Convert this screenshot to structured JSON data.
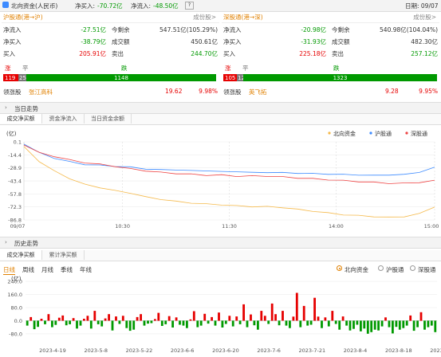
{
  "titlebar": {
    "title": "北向资金(人民币)",
    "inflow_label": "净买入:",
    "inflow_value": "-70.72亿",
    "inflow2_label": "净流入:",
    "inflow2_value": "-48.50亿",
    "date_label": "日期: 09/07"
  },
  "sh": {
    "name": "沪股通(港→沪)",
    "link": "成份股>",
    "rows": [
      {
        "l1": "净流入",
        "v1": "-27.51亿",
        "l2": "今剩余",
        "v2": "547.51亿(105.29%)"
      },
      {
        "l1": "净买入",
        "v1": "-38.79亿",
        "l2": "成交额",
        "v2": "450.61亿"
      },
      {
        "l1": "买入",
        "v1": "205.91亿",
        "l2": "卖出",
        "v2": "244.70亿"
      }
    ],
    "up_label": "涨",
    "flat_label": "平",
    "down_label": "跌",
    "up": "119",
    "flat": "25",
    "down": "1148",
    "leader_label": "领涨股",
    "leader_name": "张江高科",
    "leader_price": "19.62",
    "leader_pct": "9.98%"
  },
  "sz": {
    "name": "深股通(港→深)",
    "link": "成份股>",
    "rows": [
      {
        "l1": "净流入",
        "v1": "-20.98亿",
        "l2": "今剩余",
        "v2": "540.98亿(104.04%)"
      },
      {
        "l1": "净买入",
        "v1": "-31.93亿",
        "l2": "成交额",
        "v2": "482.30亿"
      },
      {
        "l1": "买入",
        "v1": "225.18亿",
        "l2": "卖出",
        "v2": "257.12亿"
      }
    ],
    "up_label": "涨",
    "flat_label": "平",
    "down_label": "跌",
    "up": "105",
    "flat": "12",
    "down": "1323",
    "leader_label": "领涨股",
    "leader_name": "英飞拓",
    "leader_price": "9.28",
    "leader_pct": "9.95%"
  },
  "intraday": {
    "section_title": "当日走势",
    "tabs": [
      "成交净买额",
      "资金净流入",
      "当日资金余额"
    ],
    "unit": "(亿)",
    "legend": [
      "北向资金",
      "沪股通",
      "深股通"
    ]
  },
  "history": {
    "section_title": "历史走势",
    "tabs": [
      "成交净买额",
      "累计净买额"
    ],
    "periods": [
      "日线",
      "周线",
      "月线",
      "季线",
      "年线"
    ],
    "radios": [
      "北向资金",
      "沪股通",
      "深股通"
    ],
    "unit": "(亿)"
  },
  "colors": {
    "north": "#f5b94a",
    "sh": "#3d8bff",
    "sz": "#ee4444",
    "up": "#e60000",
    "down": "#009900"
  },
  "chart_data": [
    {
      "type": "line",
      "y_ticks": [
        "0.1",
        "-14.4",
        "-28.9",
        "-43.4",
        "-57.8",
        "-72.3",
        "-86.8"
      ],
      "x_ticks": [
        "09/07",
        "10:30",
        "11:30",
        "14:00",
        "15:00"
      ],
      "ylim": [
        -86.8,
        0.1
      ],
      "series": [
        {
          "name": "北向资金",
          "values": [
            -5,
            -22,
            -32,
            -41,
            -47,
            -51,
            -54,
            -57,
            -61,
            -64,
            -66,
            -68,
            -69,
            -70,
            -71,
            -72,
            -72,
            -73,
            -75,
            -77,
            -79,
            -81,
            -82,
            -83,
            -84,
            -83,
            -80,
            -72
          ]
        },
        {
          "name": "沪股通",
          "values": [
            -2,
            -12,
            -18,
            -22,
            -25,
            -26,
            -27,
            -28,
            -30,
            -31,
            -31,
            -32,
            -32,
            -33,
            -33,
            -34,
            -34,
            -34,
            -35,
            -35,
            -36,
            -36,
            -37,
            -37,
            -37,
            -36,
            -34,
            -28
          ]
        },
        {
          "name": "深股通",
          "values": [
            -3,
            -12,
            -16,
            -20,
            -23,
            -25,
            -27,
            -30,
            -32,
            -34,
            -35,
            -36,
            -37,
            -37,
            -38,
            -38,
            -38,
            -39,
            -40,
            -41,
            -42,
            -43,
            -44,
            -45,
            -46,
            -46,
            -45,
            -43
          ]
        }
      ]
    },
    {
      "type": "bar",
      "y_ticks": [
        "240.0",
        "160.0",
        "80.0",
        "0.0",
        "-80.0"
      ],
      "x_ticks": [
        "2023-4-19",
        "2023-5-8",
        "2023-5-22",
        "2023-6-6",
        "2023-6-20",
        "2023-7-6",
        "2023-7-21",
        "2023-8-4",
        "2023-8-18",
        "2023-9-4"
      ],
      "ylim": [
        -100,
        260
      ],
      "values": [
        -30,
        22,
        -52,
        -38,
        12,
        -22,
        40,
        -40,
        -26,
        18,
        32,
        -28,
        -22,
        16,
        -48,
        -30,
        12,
        30,
        -48,
        60,
        -22,
        -35,
        14,
        40,
        -60,
        26,
        -20,
        30,
        -45,
        -62,
        -55,
        22,
        40,
        -30,
        -18,
        -15,
        10,
        48,
        -32,
        -22,
        28,
        -42,
        20,
        -25,
        -30,
        -45,
        8,
        58,
        -40,
        -30,
        42,
        -18,
        22,
        -30,
        50,
        -42,
        -20,
        30,
        -35,
        26,
        -22,
        100,
        -40,
        38,
        -28,
        -55,
        60,
        30,
        -20,
        105,
        40,
        -28,
        60,
        -30,
        -45,
        25,
        170,
        -40,
        90,
        -30,
        -25,
        140,
        25,
        -45,
        20,
        -35,
        60,
        -20,
        -55,
        26,
        -30,
        -60,
        -50,
        -25,
        -65,
        -48,
        -80,
        -70,
        -55,
        -60,
        -35,
        20,
        -40,
        -78,
        -38,
        -55,
        -45,
        -30,
        32,
        -62,
        -40,
        52,
        -55,
        -40,
        -30,
        -70
      ]
    }
  ]
}
